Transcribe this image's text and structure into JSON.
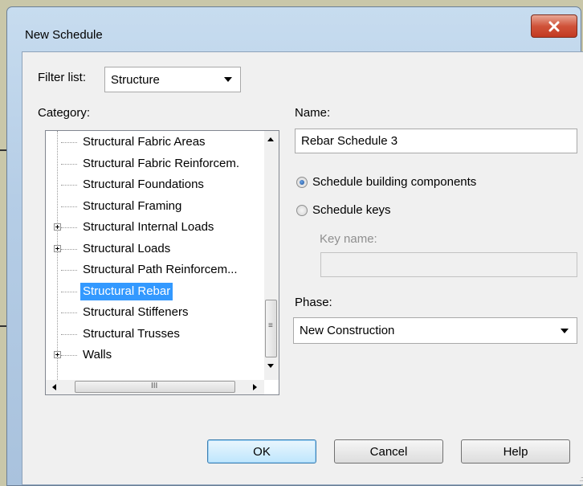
{
  "window": {
    "title": "New Schedule"
  },
  "filter": {
    "label": "Filter list:",
    "value": "Structure"
  },
  "category": {
    "label": "Category:",
    "items": [
      {
        "label": "Structural Fabric Areas",
        "expandable": false,
        "selected": false
      },
      {
        "label": "Structural Fabric Reinforcem.",
        "expandable": false,
        "selected": false
      },
      {
        "label": "Structural Foundations",
        "expandable": false,
        "selected": false
      },
      {
        "label": "Structural Framing",
        "expandable": false,
        "selected": false
      },
      {
        "label": "Structural Internal Loads",
        "expandable": true,
        "selected": false
      },
      {
        "label": "Structural Loads",
        "expandable": true,
        "selected": false
      },
      {
        "label": "Structural Path Reinforcem...",
        "expandable": false,
        "selected": false
      },
      {
        "label": "Structural Rebar",
        "expandable": false,
        "selected": true
      },
      {
        "label": "Structural Stiffeners",
        "expandable": false,
        "selected": false
      },
      {
        "label": "Structural Trusses",
        "expandable": false,
        "selected": false
      },
      {
        "label": "Walls",
        "expandable": true,
        "selected": false
      }
    ]
  },
  "name": {
    "label": "Name:",
    "value": "Rebar Schedule 3"
  },
  "options": {
    "schedule_components": "Schedule building components",
    "schedule_keys": "Schedule keys",
    "selected": "schedule_components"
  },
  "key_name": {
    "label": "Key name:",
    "value": ""
  },
  "phase": {
    "label": "Phase:",
    "value": "New Construction"
  },
  "buttons": {
    "ok": "OK",
    "cancel": "Cancel",
    "help": "Help"
  }
}
